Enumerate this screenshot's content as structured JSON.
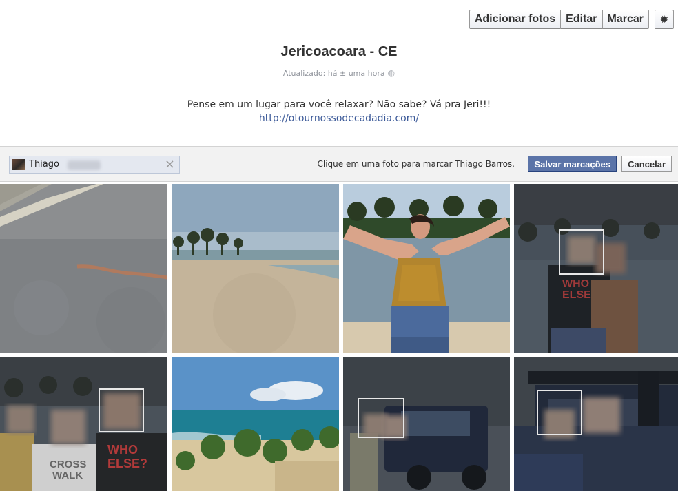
{
  "toolbar": {
    "add_photos_label": "Adicionar fotos",
    "edit_label": "Editar",
    "tag_label": "Marcar",
    "settings_icon": "gear-icon"
  },
  "album": {
    "title": "Jericoacoara - CE",
    "updated": "Atualizado: há ± uma hora",
    "privacy_icon": "globe-icon",
    "description": "Pense em um lugar para você relaxar? Não sabe? Vá pra Jeri!!!",
    "link": "http://otournossodecadadia.com/"
  },
  "tagging": {
    "token_name": "Thiago",
    "remove_icon": "close-icon",
    "help_text": "Clique em uma foto para marcar Thiago Barros.",
    "save_label": "Salvar marcações",
    "cancel_label": "Cancelar"
  },
  "colors": {
    "link": "#3b5998",
    "save_button": "#5b74a8",
    "tag_bar_bg": "#f2f2f2"
  }
}
